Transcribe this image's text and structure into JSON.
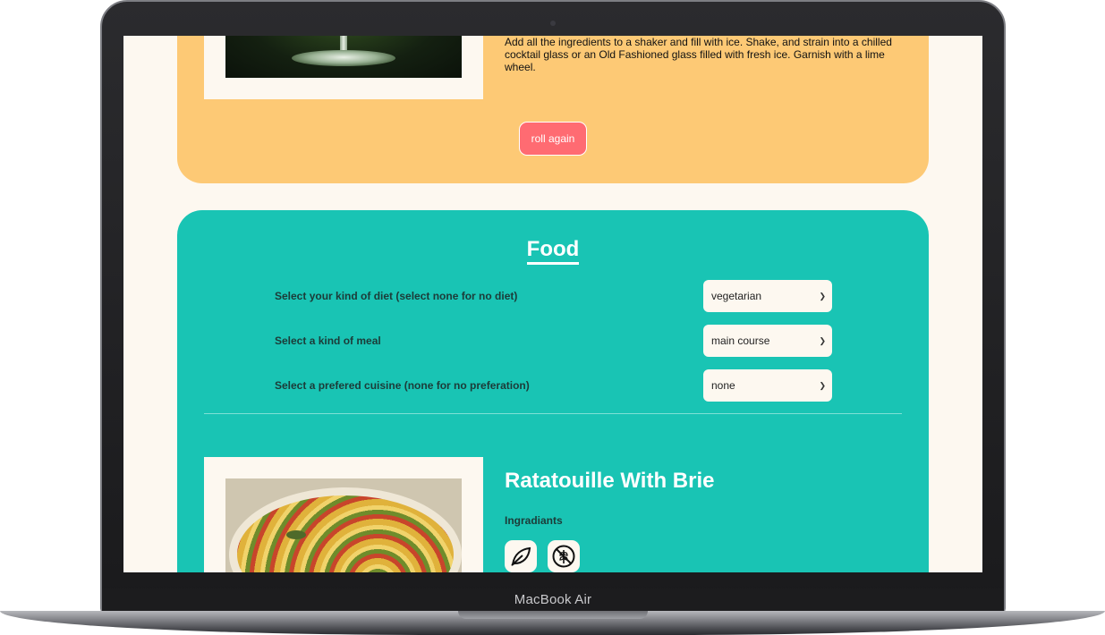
{
  "device": {
    "label": "MacBook Air"
  },
  "drink": {
    "instructions": "Add all the ingredients to a shaker and fill with ice. Shake, and strain into a chilled cocktail glass or an Old Fashioned glass filled with fresh ice. Garnish with a lime wheel.",
    "roll_button": "roll again"
  },
  "food": {
    "title": "Food",
    "filters": [
      {
        "label": "Select your kind of diet (select none for no diet)",
        "value": "vegetarian"
      },
      {
        "label": "Select a kind of meal",
        "value": "main course"
      },
      {
        "label": "Select a prefered cuisine (none for no preferation)",
        "value": "none"
      }
    ],
    "recipe": {
      "title": "Ratatouille With Brie",
      "ingredients_label": "Ingradiants",
      "badges": [
        "leaf-icon",
        "gluten-free-icon"
      ]
    }
  },
  "colors": {
    "drink_panel": "#fdc975",
    "food_panel": "#19c4b4",
    "button": "#ff6b72",
    "page_bg": "#fdf8f0"
  }
}
